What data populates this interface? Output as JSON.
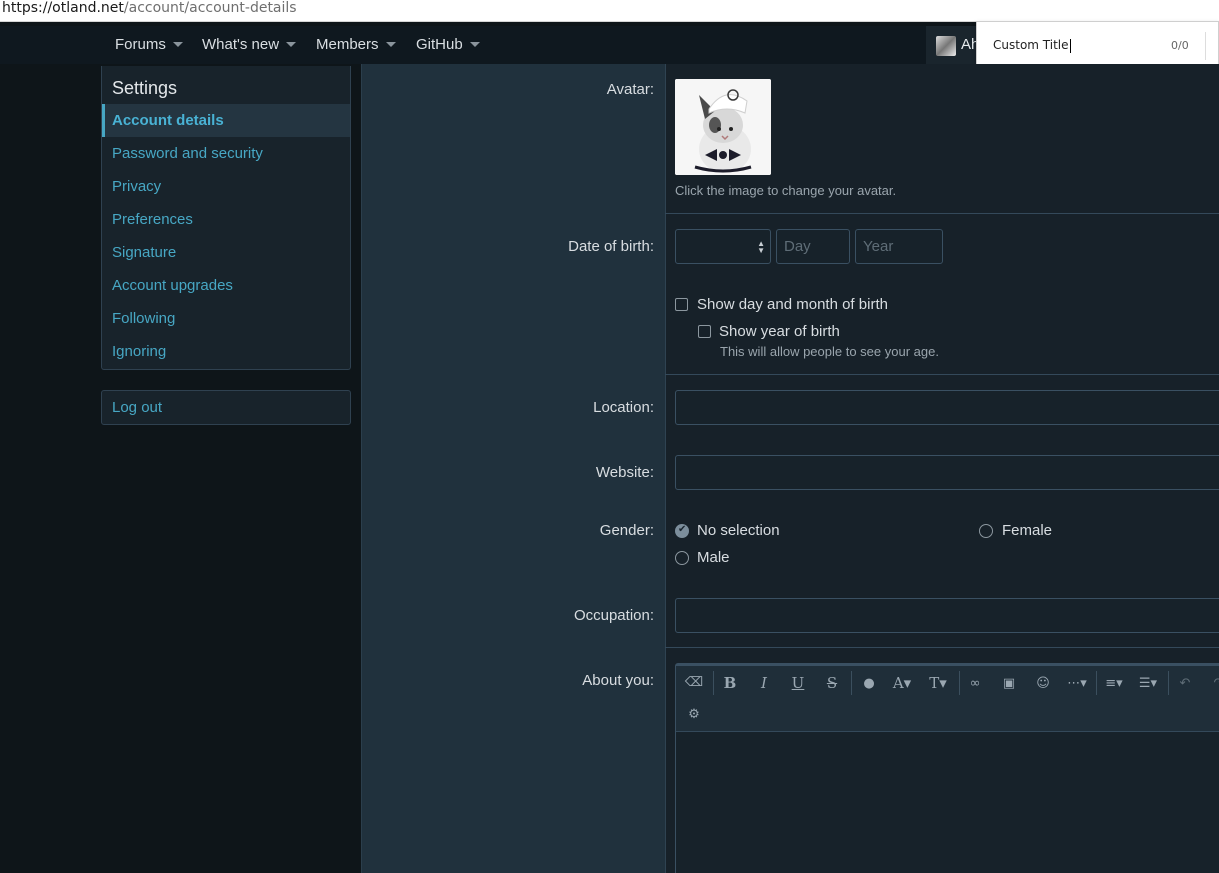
{
  "browser": {
    "url_host": "https://otland.net",
    "url_path": "/account/account-details"
  },
  "nav": {
    "items": [
      "Forums",
      "What's new",
      "Members",
      "GitHub"
    ],
    "user_name": "Ah"
  },
  "findbar": {
    "query": "Custom Title",
    "count": "0/0"
  },
  "sidebar": {
    "title": "Settings",
    "items": [
      "Account details",
      "Password and security",
      "Privacy",
      "Preferences",
      "Signature",
      "Account upgrades",
      "Following",
      "Ignoring"
    ],
    "active_index": 0,
    "logout": "Log out"
  },
  "form": {
    "avatar_label": "Avatar:",
    "avatar_hint": "Click the image to change your avatar.",
    "dob_label": "Date of birth:",
    "day_placeholder": "Day",
    "year_placeholder": "Year",
    "show_day_month": "Show day and month of birth",
    "show_year": "Show year of birth",
    "show_year_hint": "This will allow people to see your age.",
    "location_label": "Location:",
    "website_label": "Website:",
    "gender_label": "Gender:",
    "gender_options": [
      "No selection",
      "Female",
      "Male"
    ],
    "gender_selected": "No selection",
    "occupation_label": "Occupation:",
    "about_label": "About you:"
  },
  "editor_toolbar": {
    "buttons": [
      "eraser",
      "bold",
      "italic",
      "underline",
      "strikethrough",
      "text-color",
      "font-family",
      "font-size",
      "link",
      "image",
      "smilies",
      "more",
      "align",
      "list",
      "undo",
      "redo",
      "settings"
    ]
  },
  "colors": {
    "link": "#47a7c4",
    "page_bg": "#0e1519",
    "panel_bg": "#18232b",
    "nav_bg": "#0f181f"
  }
}
